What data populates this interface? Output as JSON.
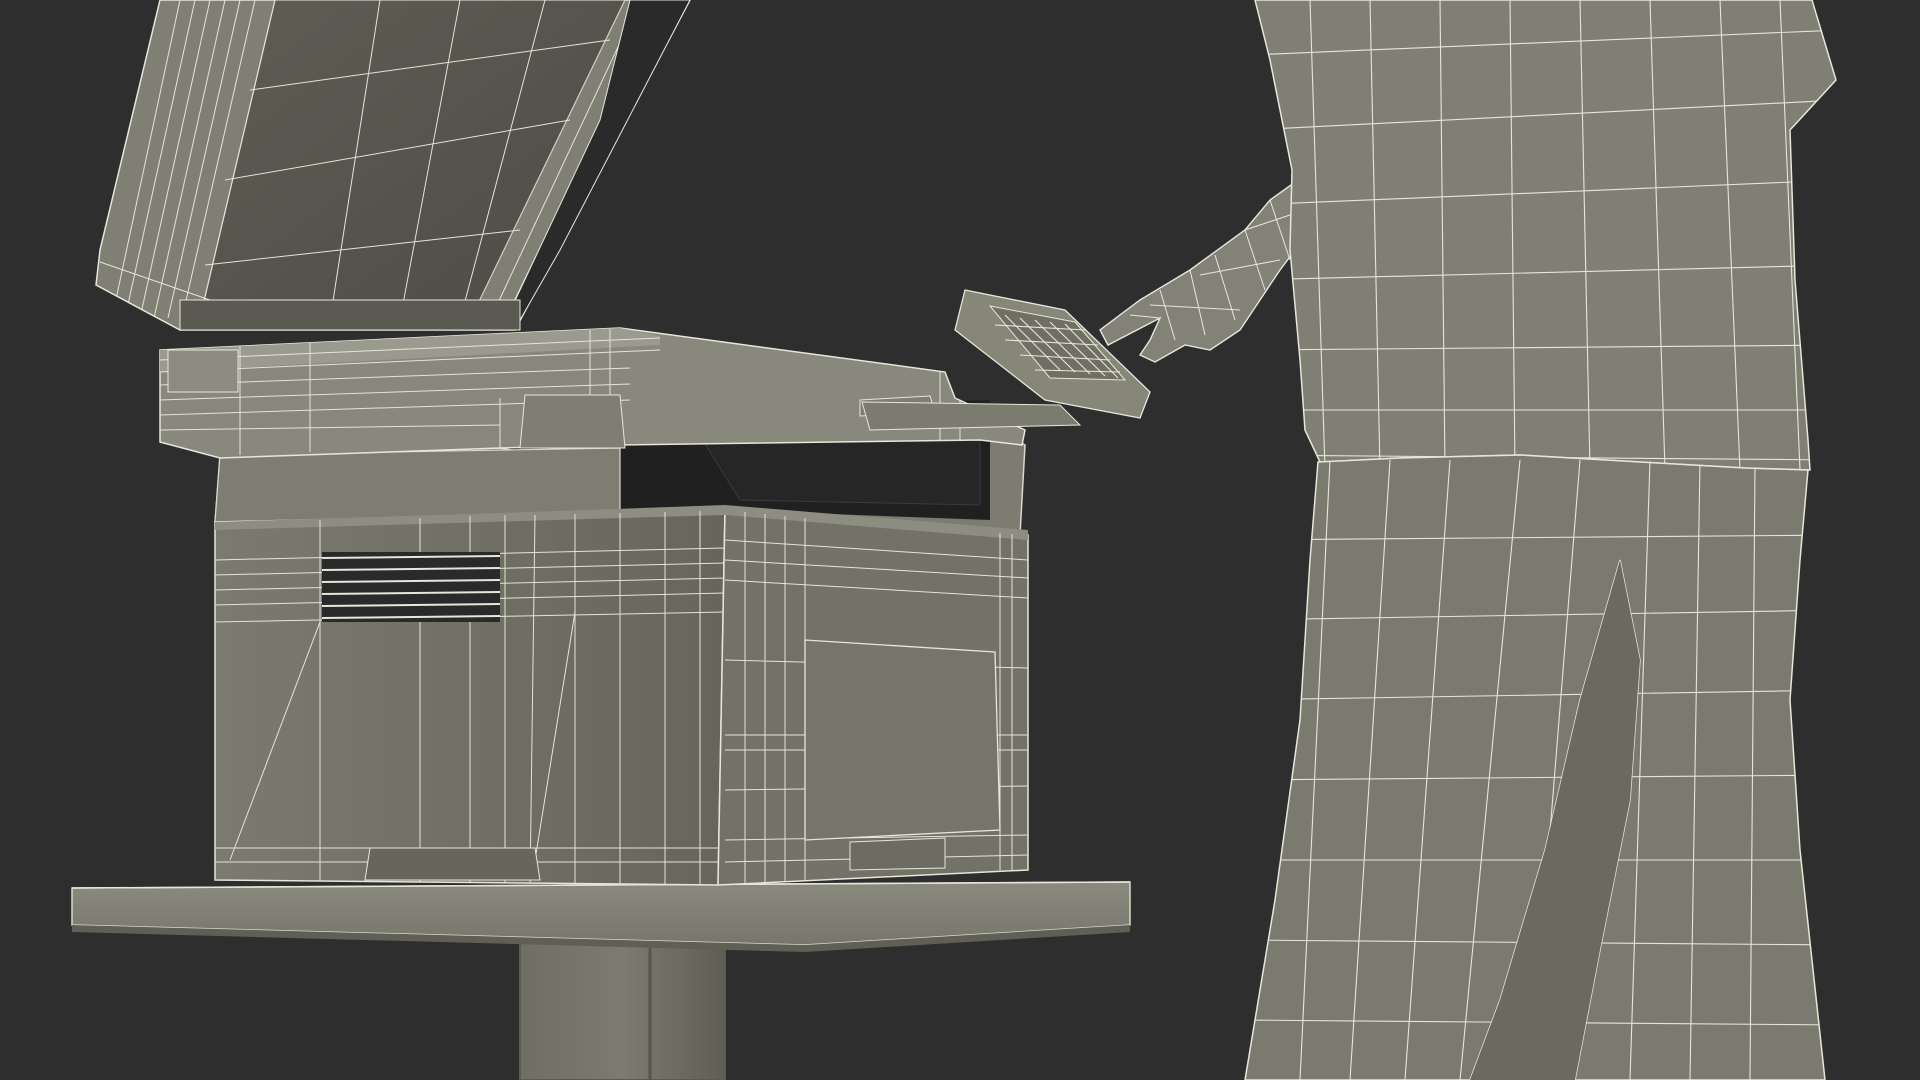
{
  "scene": {
    "subject": "wireframe-render",
    "colors": {
      "background": "#2e2e2e",
      "surface_light": "#85857a",
      "surface_mid": "#727266",
      "surface_dark": "#5c5c52",
      "surface_shadow": "#454540",
      "wire": "#e6e6da",
      "gap": "#1c1c1c"
    }
  }
}
